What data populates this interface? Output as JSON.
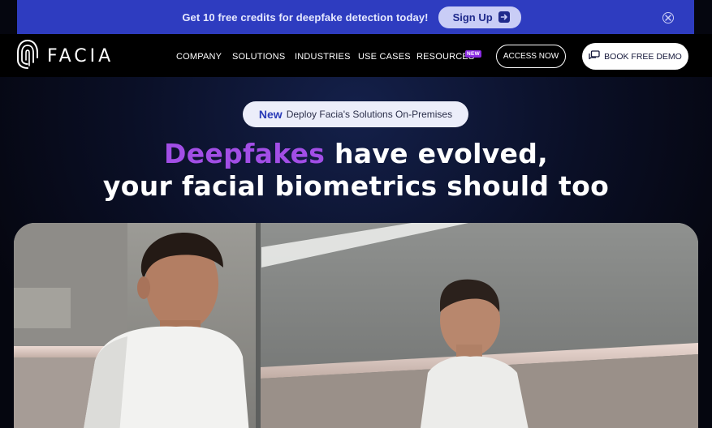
{
  "promo": {
    "text": "Get 10 free credits for deepfake detection today!",
    "signup_label": "Sign Up"
  },
  "nav": {
    "logo_text": "FACIA",
    "items": [
      "COMPANY",
      "SOLUTIONS",
      "INDUSTRIES",
      "USE CASES",
      "RESOURCES"
    ],
    "new_badge": "NEW",
    "access_label": "ACCESS NOW",
    "demo_label": "BOOK FREE DEMO"
  },
  "hero": {
    "pill_new": "New",
    "pill_text": "Deploy Facia's Solutions On-Premises",
    "headline_accent": "Deepfakes",
    "headline_rest": " have evolved,",
    "headline_line2": "your facial biometrics should too"
  },
  "colors": {
    "promo_bg": "#2e3cc0",
    "accent_purple": "#a24ee6",
    "badge_purple": "#8a2be2",
    "page_bg": "#05060f"
  },
  "icons": [
    "fingerprint-logo-icon",
    "arrow-right-icon",
    "close-circle-icon",
    "chat-icon"
  ]
}
